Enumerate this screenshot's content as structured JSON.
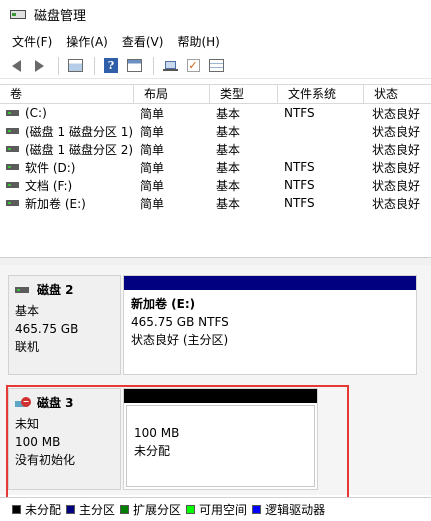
{
  "window": {
    "title": "磁盘管理",
    "icon": "disk-management-icon"
  },
  "menu": [
    "文件(F)",
    "操作(A)",
    "查看(V)",
    "帮助(H)"
  ],
  "toolbar": {
    "icons": [
      "back-arrow-icon",
      "forward-arrow-icon",
      "console-tree-icon",
      "help-icon",
      "properties-icon",
      "connect-disk-icon",
      "check-icon",
      "list-view-icon"
    ],
    "help_glyph": "?",
    "check_glyph": "✓"
  },
  "volume_list": {
    "columns": [
      "卷",
      "布局",
      "类型",
      "文件系统",
      "状态"
    ],
    "rows": [
      {
        "name": "(C:)",
        "layout": "简单",
        "type": "基本",
        "fs": "NTFS",
        "status": "状态良好"
      },
      {
        "name": "(磁盘 1 磁盘分区 1)",
        "layout": "简单",
        "type": "基本",
        "fs": "",
        "status": "状态良好"
      },
      {
        "name": "(磁盘 1 磁盘分区 2)",
        "layout": "简单",
        "type": "基本",
        "fs": "",
        "status": "状态良好"
      },
      {
        "name": "软件 (D:)",
        "layout": "简单",
        "type": "基本",
        "fs": "NTFS",
        "status": "状态良好"
      },
      {
        "name": "文档 (F:)",
        "layout": "简单",
        "type": "基本",
        "fs": "NTFS",
        "status": "状态良好"
      },
      {
        "name": "新加卷 (E:)",
        "layout": "简单",
        "type": "基本",
        "fs": "NTFS",
        "status": "状态良好"
      }
    ]
  },
  "disks": [
    {
      "name": "磁盘 2",
      "type": "基本",
      "size": "465.75 GB",
      "state": "联机",
      "partition": {
        "title": "新加卷  (E:)",
        "detail": "465.75 GB NTFS",
        "status": "状态良好 (主分区)",
        "bar_color": "#000080"
      }
    },
    {
      "name": "磁盘 3",
      "type": "未知",
      "size": "100 MB",
      "state": "没有初始化",
      "partition": {
        "title": "",
        "detail": "100 MB",
        "status": "未分配",
        "bar_color": "#000000"
      }
    }
  ],
  "legend": [
    {
      "label": "未分配",
      "color": "#000000"
    },
    {
      "label": "主分区",
      "color": "#000080"
    },
    {
      "label": "扩展分区",
      "color": "#008000"
    },
    {
      "label": "可用空间",
      "color": "#00ff00"
    },
    {
      "label": "逻辑驱动器",
      "color": "#0000ff"
    }
  ]
}
